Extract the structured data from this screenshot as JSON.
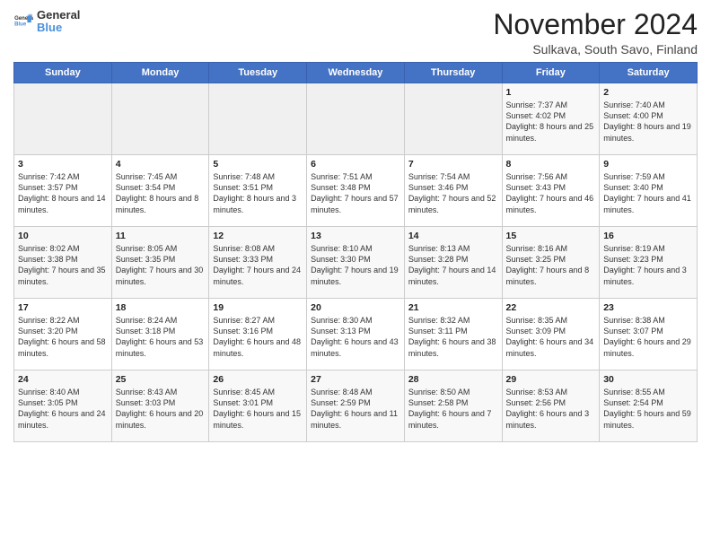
{
  "header": {
    "logo_general": "General",
    "logo_blue": "Blue",
    "month": "November 2024",
    "location": "Sulkava, South Savo, Finland"
  },
  "weekdays": [
    "Sunday",
    "Monday",
    "Tuesday",
    "Wednesday",
    "Thursday",
    "Friday",
    "Saturday"
  ],
  "weeks": [
    [
      {
        "day": "",
        "info": ""
      },
      {
        "day": "",
        "info": ""
      },
      {
        "day": "",
        "info": ""
      },
      {
        "day": "",
        "info": ""
      },
      {
        "day": "",
        "info": ""
      },
      {
        "day": "1",
        "info": "Sunrise: 7:37 AM\nSunset: 4:02 PM\nDaylight: 8 hours\nand 25 minutes."
      },
      {
        "day": "2",
        "info": "Sunrise: 7:40 AM\nSunset: 4:00 PM\nDaylight: 8 hours\nand 19 minutes."
      }
    ],
    [
      {
        "day": "3",
        "info": "Sunrise: 7:42 AM\nSunset: 3:57 PM\nDaylight: 8 hours\nand 14 minutes."
      },
      {
        "day": "4",
        "info": "Sunrise: 7:45 AM\nSunset: 3:54 PM\nDaylight: 8 hours\nand 8 minutes."
      },
      {
        "day": "5",
        "info": "Sunrise: 7:48 AM\nSunset: 3:51 PM\nDaylight: 8 hours\nand 3 minutes."
      },
      {
        "day": "6",
        "info": "Sunrise: 7:51 AM\nSunset: 3:48 PM\nDaylight: 7 hours\nand 57 minutes."
      },
      {
        "day": "7",
        "info": "Sunrise: 7:54 AM\nSunset: 3:46 PM\nDaylight: 7 hours\nand 52 minutes."
      },
      {
        "day": "8",
        "info": "Sunrise: 7:56 AM\nSunset: 3:43 PM\nDaylight: 7 hours\nand 46 minutes."
      },
      {
        "day": "9",
        "info": "Sunrise: 7:59 AM\nSunset: 3:40 PM\nDaylight: 7 hours\nand 41 minutes."
      }
    ],
    [
      {
        "day": "10",
        "info": "Sunrise: 8:02 AM\nSunset: 3:38 PM\nDaylight: 7 hours\nand 35 minutes."
      },
      {
        "day": "11",
        "info": "Sunrise: 8:05 AM\nSunset: 3:35 PM\nDaylight: 7 hours\nand 30 minutes."
      },
      {
        "day": "12",
        "info": "Sunrise: 8:08 AM\nSunset: 3:33 PM\nDaylight: 7 hours\nand 24 minutes."
      },
      {
        "day": "13",
        "info": "Sunrise: 8:10 AM\nSunset: 3:30 PM\nDaylight: 7 hours\nand 19 minutes."
      },
      {
        "day": "14",
        "info": "Sunrise: 8:13 AM\nSunset: 3:28 PM\nDaylight: 7 hours\nand 14 minutes."
      },
      {
        "day": "15",
        "info": "Sunrise: 8:16 AM\nSunset: 3:25 PM\nDaylight: 7 hours\nand 8 minutes."
      },
      {
        "day": "16",
        "info": "Sunrise: 8:19 AM\nSunset: 3:23 PM\nDaylight: 7 hours\nand 3 minutes."
      }
    ],
    [
      {
        "day": "17",
        "info": "Sunrise: 8:22 AM\nSunset: 3:20 PM\nDaylight: 6 hours\nand 58 minutes."
      },
      {
        "day": "18",
        "info": "Sunrise: 8:24 AM\nSunset: 3:18 PM\nDaylight: 6 hours\nand 53 minutes."
      },
      {
        "day": "19",
        "info": "Sunrise: 8:27 AM\nSunset: 3:16 PM\nDaylight: 6 hours\nand 48 minutes."
      },
      {
        "day": "20",
        "info": "Sunrise: 8:30 AM\nSunset: 3:13 PM\nDaylight: 6 hours\nand 43 minutes."
      },
      {
        "day": "21",
        "info": "Sunrise: 8:32 AM\nSunset: 3:11 PM\nDaylight: 6 hours\nand 38 minutes."
      },
      {
        "day": "22",
        "info": "Sunrise: 8:35 AM\nSunset: 3:09 PM\nDaylight: 6 hours\nand 34 minutes."
      },
      {
        "day": "23",
        "info": "Sunrise: 8:38 AM\nSunset: 3:07 PM\nDaylight: 6 hours\nand 29 minutes."
      }
    ],
    [
      {
        "day": "24",
        "info": "Sunrise: 8:40 AM\nSunset: 3:05 PM\nDaylight: 6 hours\nand 24 minutes."
      },
      {
        "day": "25",
        "info": "Sunrise: 8:43 AM\nSunset: 3:03 PM\nDaylight: 6 hours\nand 20 minutes."
      },
      {
        "day": "26",
        "info": "Sunrise: 8:45 AM\nSunset: 3:01 PM\nDaylight: 6 hours\nand 15 minutes."
      },
      {
        "day": "27",
        "info": "Sunrise: 8:48 AM\nSunset: 2:59 PM\nDaylight: 6 hours\nand 11 minutes."
      },
      {
        "day": "28",
        "info": "Sunrise: 8:50 AM\nSunset: 2:58 PM\nDaylight: 6 hours\nand 7 minutes."
      },
      {
        "day": "29",
        "info": "Sunrise: 8:53 AM\nSunset: 2:56 PM\nDaylight: 6 hours\nand 3 minutes."
      },
      {
        "day": "30",
        "info": "Sunrise: 8:55 AM\nSunset: 2:54 PM\nDaylight: 5 hours\nand 59 minutes."
      }
    ]
  ]
}
